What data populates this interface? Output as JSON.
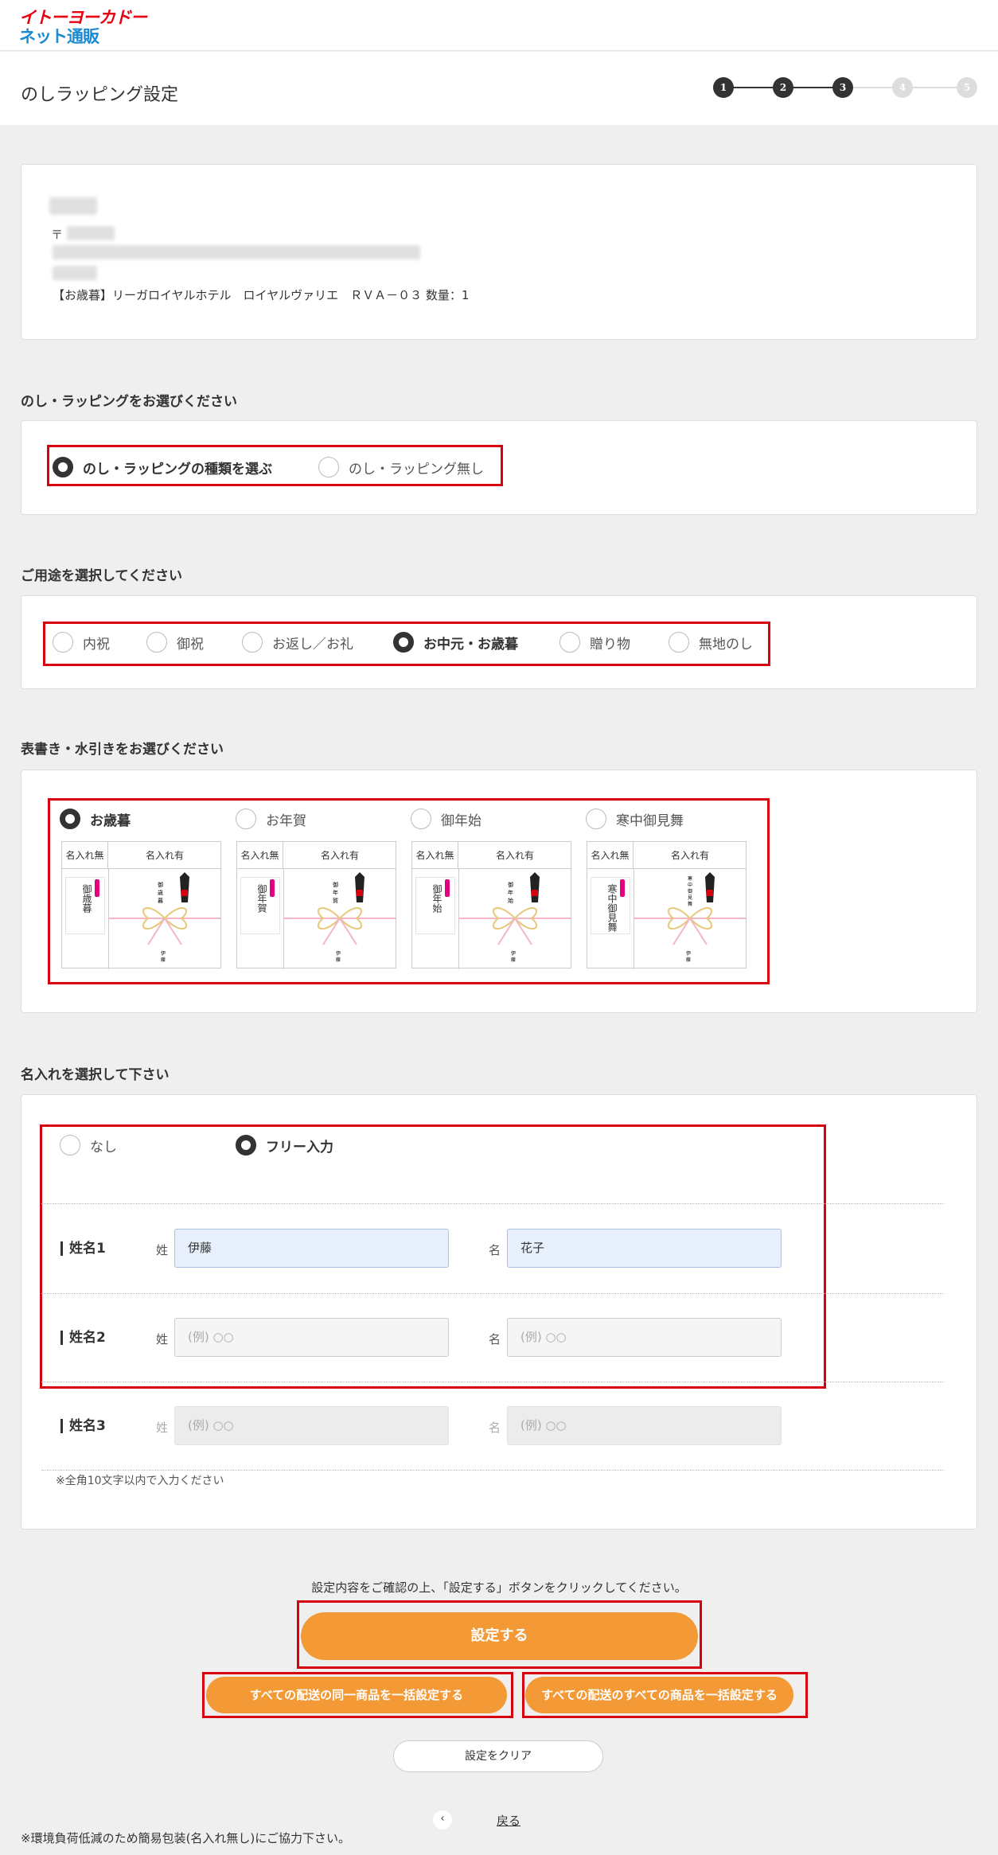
{
  "header": {
    "logo_line1": "イトーヨーカドー",
    "logo_line2": "ネット通販",
    "page_title": "のしラッピング設定",
    "steps": [
      "1",
      "2",
      "3",
      "4",
      "5"
    ]
  },
  "address": {
    "postal_mark": "〒",
    "item_line": "【お歳暮】リーガロイヤルホテル　ロイヤルヴァリエ　ＲＶＡ－０３ 数量：1"
  },
  "wrap_section": {
    "title": "のし・ラッピングをお選びください",
    "options": [
      "のし・ラッピングの種類を選ぶ",
      "のし・ラッピング無し"
    ],
    "selected": 0
  },
  "purpose_section": {
    "title": "ご用途を選択してください",
    "options": [
      "内祝",
      "御祝",
      "お返し／お礼",
      "お中元・お歳暮",
      "贈り物",
      "無地のし"
    ],
    "selected": 3
  },
  "omote_section": {
    "title": "表書き・水引きをお選びください",
    "options": [
      {
        "label": "お歳暮",
        "small_text": "御歳暮"
      },
      {
        "label": "お年賀",
        "small_text": "御年賀"
      },
      {
        "label": "御年始",
        "small_text": "御年始"
      },
      {
        "label": "寒中御見舞",
        "small_text": "寒中御見舞"
      }
    ],
    "col_no_name": "名入れ無",
    "col_with_name": "名入れ有",
    "selected": 0
  },
  "name_section": {
    "title": "名入れを選択して下さい",
    "options": [
      "なし",
      "フリー入力"
    ],
    "selected": 1,
    "rows": [
      {
        "label": "姓名1",
        "sei_label": "姓",
        "mei_label": "名",
        "sei_value": "伊藤",
        "mei_value": "花子"
      },
      {
        "label": "姓名2",
        "sei_label": "姓",
        "mei_label": "名",
        "sei_placeholder": "(例) ○○",
        "mei_placeholder": "(例) ○○"
      },
      {
        "label": "姓名3",
        "sei_label": "姓",
        "mei_label": "名",
        "sei_placeholder": "(例) ○○",
        "mei_placeholder": "(例) ○○"
      }
    ],
    "note": "※全角10文字以内で入力ください"
  },
  "footer": {
    "instruction": "設定内容をご確認の上、「設定する」ボタンをクリックしてください。",
    "set_button": "設定する",
    "bulk_same_button": "すべての配送の同一商品を一括設定する",
    "bulk_all_button": "すべての配送のすべての商品を一括設定する",
    "clear_button": "設定をクリア",
    "back_link": "戻る",
    "back_icon": "chevron-left-icon",
    "eco_note": "※環境負荷低減のため簡易包装(名入れ無し)にご協力下さい。"
  },
  "colors": {
    "accent_orange": "#f39a37",
    "highlight_red": "#d7000f",
    "logo_red": "#e60012",
    "logo_blue": "#1a8ad4"
  }
}
